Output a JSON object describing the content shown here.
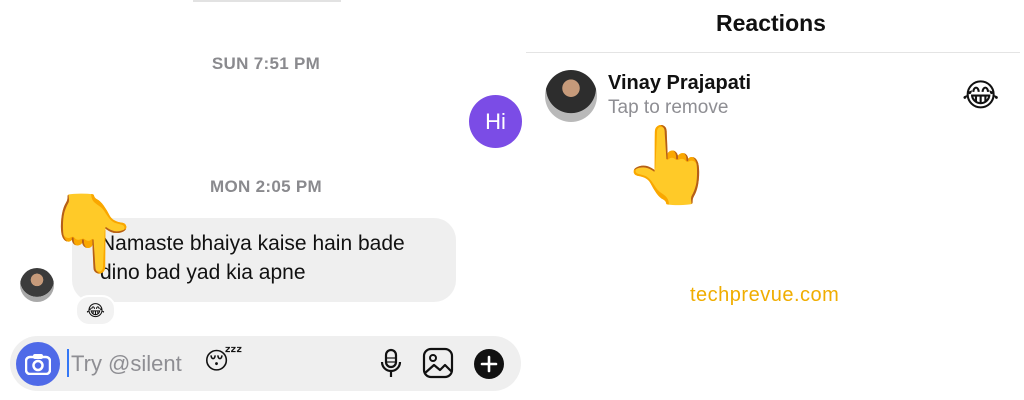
{
  "chat": {
    "timestamp_1": "SUN 7:51 PM",
    "sent_message": "Hi",
    "timestamp_2": "MON 2:05 PM",
    "received_message_line1": "Namaste bhaiya kaise hain bade",
    "received_message_line2": "dino bad yad kia apne",
    "reaction_emoji": "😂",
    "pointer_emoji": "👇"
  },
  "composer": {
    "placeholder": "Try @silent",
    "placeholder_emoji": "😴",
    "icons": [
      "camera-icon",
      "microphone-icon",
      "gallery-icon",
      "add-icon"
    ]
  },
  "reactions_panel": {
    "title": "Reactions",
    "user_name": "Vinay Prajapati",
    "subtitle": "Tap to remove",
    "emoji": "😂",
    "pointer_emoji": "👆"
  },
  "watermark": "techprevue.com",
  "colors": {
    "sent_bubble": "#7b4ce6",
    "camera_button": "#4f6ae8",
    "received_bubble": "#efefef",
    "watermark": "#f0ad00"
  }
}
